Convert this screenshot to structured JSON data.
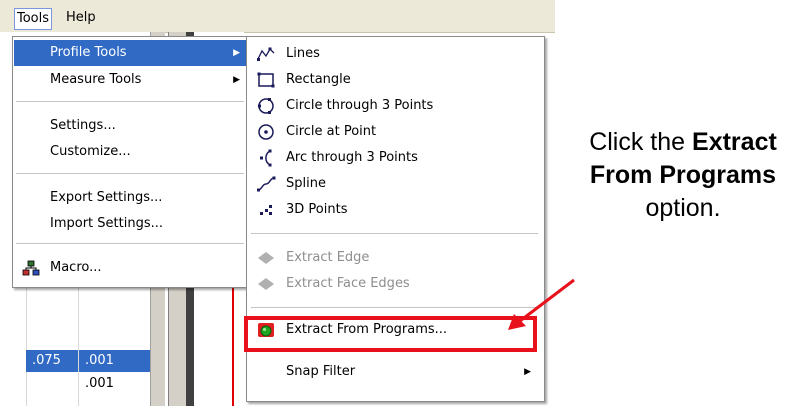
{
  "menubar": {
    "tools": "Tools",
    "help": "Help"
  },
  "tools_menu": {
    "items": [
      {
        "label": "Profile Tools",
        "has_submenu": true,
        "highlighted": true
      },
      {
        "label": "Measure Tools",
        "has_submenu": true
      },
      {
        "label": "Settings..."
      },
      {
        "label": "Customize..."
      },
      {
        "label": "Export Settings..."
      },
      {
        "label": "Import Settings..."
      },
      {
        "label": "Macro...",
        "icon": "macro-icon"
      }
    ]
  },
  "profile_submenu": {
    "items": [
      {
        "label": "Lines",
        "icon": "lines-icon"
      },
      {
        "label": "Rectangle",
        "icon": "rectangle-icon"
      },
      {
        "label": "Circle through 3 Points",
        "icon": "circle-3-points-icon"
      },
      {
        "label": "Circle at Point",
        "icon": "circle-at-point-icon"
      },
      {
        "label": "Arc through 3 Points",
        "icon": "arc-icon"
      },
      {
        "label": "Spline",
        "icon": "spline-icon"
      },
      {
        "label": "3D Points",
        "icon": "3d-points-icon"
      },
      {
        "label": "Extract Edge",
        "icon": "extract-edge-icon",
        "disabled": true
      },
      {
        "label": "Extract Face Edges",
        "icon": "extract-face-edges-icon",
        "disabled": true
      },
      {
        "label": "Extract From Programs...",
        "icon": "extract-programs-icon"
      },
      {
        "label": "Snap Filter",
        "has_submenu": true
      }
    ]
  },
  "background_cells": {
    "a": ".075",
    "b": ".001",
    "c": ".001"
  },
  "callout": {
    "prefix": "Click the",
    "bold": "Extract From Programs",
    "suffix": "option."
  },
  "colors": {
    "highlight": "#316ac5",
    "annotation_red": "#e8101a",
    "menubar_bg": "#ece9d8"
  }
}
